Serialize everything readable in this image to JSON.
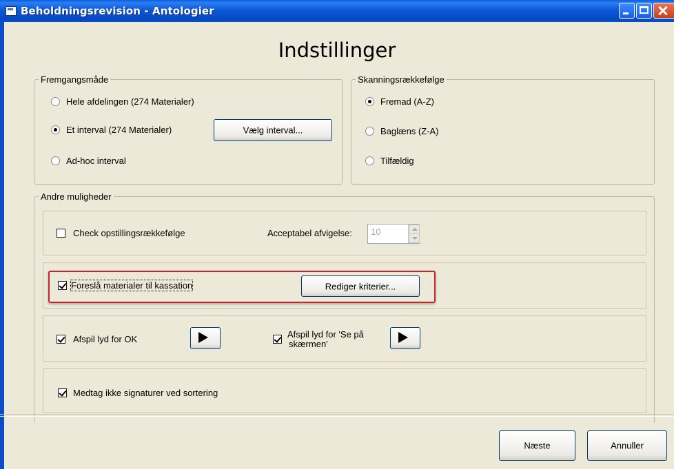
{
  "window": {
    "title": "Beholdningsrevision - Antologier",
    "heading": "Indstillinger",
    "colors": {
      "title_bar": "#0B5AD9",
      "highlight": "#C0282D",
      "dialog_bg": "#ECE9D8"
    }
  },
  "fremgangsmaade": {
    "legend": "Fremgangsmåde",
    "options": [
      {
        "label": "Hele afdelingen (274 Materialer)",
        "selected": false
      },
      {
        "label": "Et interval (274 Materialer)",
        "selected": true
      },
      {
        "label": "Ad-hoc interval",
        "selected": false
      }
    ],
    "choose_interval_button": "Vælg interval..."
  },
  "skanning": {
    "legend": "Skanningsrækkefølge",
    "options": [
      {
        "label": "Fremad (A-Z)",
        "selected": true
      },
      {
        "label": "Baglæns (Z-A)",
        "selected": false
      },
      {
        "label": "Tilfældig",
        "selected": false
      }
    ]
  },
  "andre": {
    "legend": "Andre muligheder",
    "check_order": {
      "label": "Check opstillingsrækkefølge",
      "checked": false
    },
    "deviation": {
      "label": "Acceptabel afvigelse:",
      "value": "10"
    },
    "suggest_discard": {
      "label": "Foreslå materialer til kassation",
      "checked": true
    },
    "edit_criteria_button": "Rediger kriterier...",
    "sound_ok": {
      "label": "Afspil lyd for OK",
      "checked": true
    },
    "sound_screen": {
      "label_line1": "Afspil lyd for 'Se på",
      "label_line2": "skærmen'",
      "checked": true
    },
    "exclude_signatures": {
      "label": "Medtag ikke signaturer ved sortering",
      "checked": true
    }
  },
  "footer": {
    "next_button": "Næste",
    "cancel_button": "Annuller"
  }
}
